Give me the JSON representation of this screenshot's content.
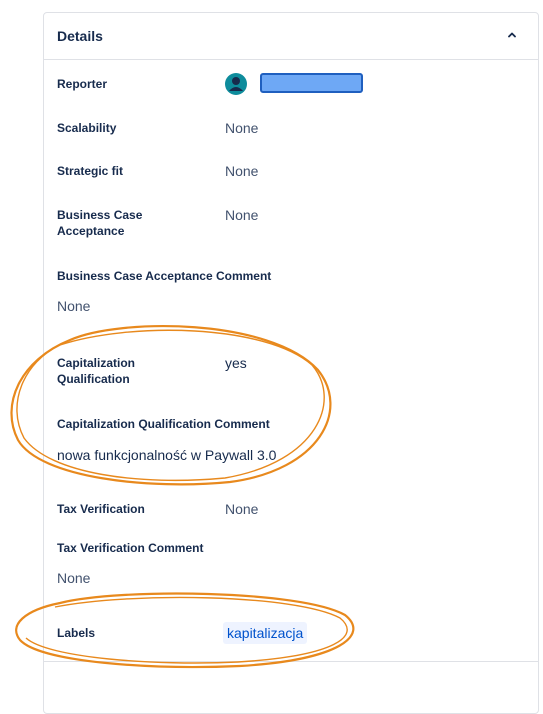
{
  "details": {
    "title": "Details",
    "fields": {
      "reporter": {
        "label": "Reporter"
      },
      "scalability": {
        "label": "Scalability",
        "value": "None"
      },
      "strategic_fit": {
        "label": "Strategic fit",
        "value": "None"
      },
      "business_case_acceptance": {
        "label_line1": "Business Case",
        "label_line2": "Acceptance",
        "value": "None"
      },
      "business_case_acceptance_comment": {
        "label": "Business Case Acceptance Comment",
        "value": "None"
      },
      "capitalization_qualification": {
        "label_line1": "Capitalization",
        "label_line2": "Qualification",
        "value": "yes"
      },
      "capitalization_qualification_comment": {
        "label": "Capitalization Qualification Comment",
        "value": "nowa funkcjonalność w Paywall 3.0"
      },
      "tax_verification": {
        "label": "Tax Verification",
        "value": "None"
      },
      "tax_verification_comment": {
        "label": "Tax Verification Comment",
        "value": "None"
      },
      "labels": {
        "label": "Labels",
        "value": "kapitalizacja"
      }
    }
  },
  "colors": {
    "annotation": "#e8891d",
    "link": "#0052cc",
    "redaction": "#6ea8f5"
  },
  "icons": {
    "collapse": "chevron-up-icon",
    "reporter_avatar": "user-avatar-icon"
  }
}
